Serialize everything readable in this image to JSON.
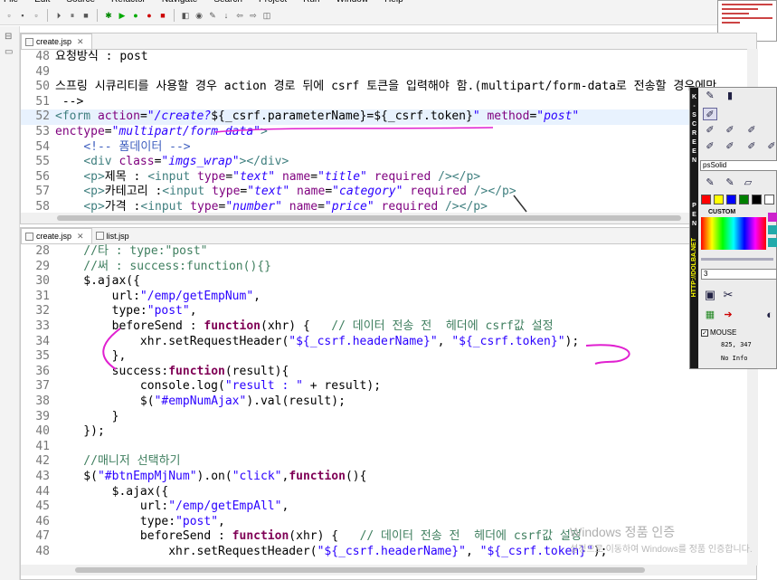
{
  "menu": [
    "File",
    "Edit",
    "Source",
    "Refactor",
    "Navigate",
    "Search",
    "Project",
    "Run",
    "Window",
    "Help"
  ],
  "top_editor": {
    "tab_label": "create.jsp",
    "tab_close": "✕",
    "lines": [
      {
        "n": "48",
        "segs": [
          {
            "c": "tx",
            "t": "요청방식 : post"
          }
        ]
      },
      {
        "n": "49",
        "segs": [
          {
            "c": "tx",
            "t": ""
          }
        ]
      },
      {
        "n": "50",
        "segs": [
          {
            "c": "tx",
            "t": "스프링 시큐리티를 사용할 경우 action 경로 뒤에 csrf 토큰을 입력해야 함.(multipart/form-data로 전송할 경우에만"
          }
        ]
      },
      {
        "n": "51",
        "segs": [
          {
            "c": "tx",
            "t": " -->"
          }
        ]
      },
      {
        "n": "52",
        "segs": [
          {
            "c": "tag",
            "t": "<form "
          },
          {
            "c": "attr",
            "t": "action"
          },
          {
            "c": "tx",
            "t": "="
          },
          {
            "c": "str",
            "t": "\"/create?"
          },
          {
            "c": "tx",
            "t": "${_csrf.parameterName}=${_csrf.token}"
          },
          {
            "c": "str",
            "t": "\""
          },
          {
            "c": "tx",
            "t": " "
          },
          {
            "c": "attr",
            "t": "method"
          },
          {
            "c": "tx",
            "t": "="
          },
          {
            "c": "str",
            "t": "\"post\""
          }
        ]
      },
      {
        "n": "53",
        "segs": [
          {
            "c": "attr",
            "t": "enctype"
          },
          {
            "c": "tx",
            "t": "="
          },
          {
            "c": "str",
            "t": "\"multipart/form-data\""
          },
          {
            "c": "tag",
            "t": ">"
          }
        ]
      },
      {
        "n": "54",
        "segs": [
          {
            "c": "tx",
            "t": "    "
          },
          {
            "c": "cm",
            "t": "<!-- 폼데이터 -->"
          }
        ]
      },
      {
        "n": "55",
        "segs": [
          {
            "c": "tx",
            "t": "    "
          },
          {
            "c": "tag",
            "t": "<div "
          },
          {
            "c": "attr",
            "t": "class"
          },
          {
            "c": "tx",
            "t": "="
          },
          {
            "c": "str",
            "t": "\"imgs_wrap\""
          },
          {
            "c": "tag",
            "t": "></div>"
          }
        ]
      },
      {
        "n": "56",
        "segs": [
          {
            "c": "tx",
            "t": "    "
          },
          {
            "c": "tag",
            "t": "<p>"
          },
          {
            "c": "tx",
            "t": "제목 : "
          },
          {
            "c": "tag",
            "t": "<input "
          },
          {
            "c": "attr",
            "t": "type"
          },
          {
            "c": "tx",
            "t": "="
          },
          {
            "c": "str",
            "t": "\"text\""
          },
          {
            "c": "tx",
            "t": " "
          },
          {
            "c": "attr",
            "t": "name"
          },
          {
            "c": "tx",
            "t": "="
          },
          {
            "c": "str",
            "t": "\"title\""
          },
          {
            "c": "tx",
            "t": " "
          },
          {
            "c": "attr",
            "t": "required"
          },
          {
            "c": "tx",
            "t": " "
          },
          {
            "c": "tag",
            "t": "/></p>"
          }
        ]
      },
      {
        "n": "57",
        "segs": [
          {
            "c": "tx",
            "t": "    "
          },
          {
            "c": "tag",
            "t": "<p>"
          },
          {
            "c": "tx",
            "t": "카테고리 :"
          },
          {
            "c": "tag",
            "t": "<input "
          },
          {
            "c": "attr",
            "t": "type"
          },
          {
            "c": "tx",
            "t": "="
          },
          {
            "c": "str",
            "t": "\"text\""
          },
          {
            "c": "tx",
            "t": " "
          },
          {
            "c": "attr",
            "t": "name"
          },
          {
            "c": "tx",
            "t": "="
          },
          {
            "c": "str",
            "t": "\"category\""
          },
          {
            "c": "tx",
            "t": " "
          },
          {
            "c": "attr",
            "t": "required"
          },
          {
            "c": "tx",
            "t": " "
          },
          {
            "c": "tag",
            "t": "/></p>"
          }
        ]
      },
      {
        "n": "58",
        "segs": [
          {
            "c": "tx",
            "t": "    "
          },
          {
            "c": "tag",
            "t": "<p>"
          },
          {
            "c": "tx",
            "t": "가격 :"
          },
          {
            "c": "tag",
            "t": "<input "
          },
          {
            "c": "attr",
            "t": "type"
          },
          {
            "c": "tx",
            "t": "="
          },
          {
            "c": "str",
            "t": "\"number\""
          },
          {
            "c": "tx",
            "t": " "
          },
          {
            "c": "attr",
            "t": "name"
          },
          {
            "c": "tx",
            "t": "="
          },
          {
            "c": "str",
            "t": "\"price\""
          },
          {
            "c": "tx",
            "t": " "
          },
          {
            "c": "attr",
            "t": "required"
          },
          {
            "c": "tx",
            "t": " "
          },
          {
            "c": "tag",
            "t": "/></p>"
          }
        ]
      }
    ]
  },
  "bottom_editor": {
    "tabs": [
      {
        "label": "create.jsp",
        "close": "✕"
      },
      {
        "label": "list.jsp",
        "close": ""
      }
    ],
    "lines": [
      {
        "n": "28",
        "segs": [
          {
            "c": "jcm",
            "t": "    //타 : type:\"post\""
          }
        ]
      },
      {
        "n": "29",
        "segs": [
          {
            "c": "jcm",
            "t": "    //써 : success:function(){}"
          }
        ]
      },
      {
        "n": "30",
        "segs": [
          {
            "c": "tx",
            "t": "    $.ajax({"
          }
        ]
      },
      {
        "n": "31",
        "segs": [
          {
            "c": "tx",
            "t": "        url:"
          },
          {
            "c": "s",
            "t": "\"/emp/getEmpNum\""
          },
          {
            "c": "tx",
            "t": ","
          }
        ]
      },
      {
        "n": "32",
        "segs": [
          {
            "c": "tx",
            "t": "        type:"
          },
          {
            "c": "s",
            "t": "\"post\""
          },
          {
            "c": "tx",
            "t": ","
          }
        ]
      },
      {
        "n": "33",
        "segs": [
          {
            "c": "tx",
            "t": "        beforeSend : "
          },
          {
            "c": "kw",
            "t": "function"
          },
          {
            "c": "tx",
            "t": "(xhr) {   "
          },
          {
            "c": "jcm",
            "t": "// 데이터 전송 전  헤더에 csrf값 설정"
          }
        ]
      },
      {
        "n": "34",
        "segs": [
          {
            "c": "tx",
            "t": "            xhr.setRequestHeader("
          },
          {
            "c": "s",
            "t": "\"${_csrf.headerName}\""
          },
          {
            "c": "tx",
            "t": ", "
          },
          {
            "c": "s",
            "t": "\"${_csrf.token}\""
          },
          {
            "c": "tx",
            "t": ");"
          }
        ]
      },
      {
        "n": "35",
        "segs": [
          {
            "c": "tx",
            "t": "        },"
          }
        ]
      },
      {
        "n": "36",
        "segs": [
          {
            "c": "tx",
            "t": "        success:"
          },
          {
            "c": "kw",
            "t": "function"
          },
          {
            "c": "tx",
            "t": "(result){"
          }
        ]
      },
      {
        "n": "37",
        "segs": [
          {
            "c": "tx",
            "t": "            console.log("
          },
          {
            "c": "s",
            "t": "\"result : \""
          },
          {
            "c": "tx",
            "t": " + result);"
          }
        ]
      },
      {
        "n": "38",
        "segs": [
          {
            "c": "tx",
            "t": "            $("
          },
          {
            "c": "s",
            "t": "\"#empNumAjax\""
          },
          {
            "c": "tx",
            "t": ").val(result);"
          }
        ]
      },
      {
        "n": "39",
        "segs": [
          {
            "c": "tx",
            "t": "        }"
          }
        ]
      },
      {
        "n": "40",
        "segs": [
          {
            "c": "tx",
            "t": "    });"
          }
        ]
      },
      {
        "n": "41",
        "segs": [
          {
            "c": "tx",
            "t": ""
          }
        ]
      },
      {
        "n": "42",
        "segs": [
          {
            "c": "jcm",
            "t": "    //매니저 선택하기"
          }
        ]
      },
      {
        "n": "43",
        "segs": [
          {
            "c": "tx",
            "t": "    $("
          },
          {
            "c": "s",
            "t": "\"#btnEmpMjNum\""
          },
          {
            "c": "tx",
            "t": ").on("
          },
          {
            "c": "s",
            "t": "\"click\""
          },
          {
            "c": "tx",
            "t": ","
          },
          {
            "c": "kw",
            "t": "function"
          },
          {
            "c": "tx",
            "t": "(){"
          }
        ]
      },
      {
        "n": "44",
        "segs": [
          {
            "c": "tx",
            "t": "        $.ajax({"
          }
        ]
      },
      {
        "n": "45",
        "segs": [
          {
            "c": "tx",
            "t": "            url:"
          },
          {
            "c": "s",
            "t": "\"/emp/getEmpAll\""
          },
          {
            "c": "tx",
            "t": ","
          }
        ]
      },
      {
        "n": "46",
        "segs": [
          {
            "c": "tx",
            "t": "            type:"
          },
          {
            "c": "s",
            "t": "\"post\""
          },
          {
            "c": "tx",
            "t": ","
          }
        ]
      },
      {
        "n": "47",
        "segs": [
          {
            "c": "tx",
            "t": "            beforeSend : "
          },
          {
            "c": "kw",
            "t": "function"
          },
          {
            "c": "tx",
            "t": "(xhr) {   "
          },
          {
            "c": "jcm",
            "t": "// 데이터 전송 전  헤더에 csrf값 설정"
          }
        ]
      },
      {
        "n": "48",
        "segs": [
          {
            "c": "tx",
            "t": "                xhr.setRequestHeader("
          },
          {
            "c": "s",
            "t": "\"${_csrf.headerName}\""
          },
          {
            "c": "tx",
            "t": ", "
          },
          {
            "c": "s",
            "t": "\"${_csrf.token}\""
          },
          {
            "c": "tx",
            "t": ");"
          }
        ]
      }
    ]
  },
  "screen_pen": {
    "strip_letters": [
      "K",
      "-",
      "S",
      "C",
      "R",
      "E",
      "E",
      "N"
    ],
    "strip_letters2": [
      "P",
      "E",
      "N"
    ],
    "link": "HTTP://DOLBA.NET",
    "style_value": "psSolid",
    "custom_label": "CUSTOM",
    "width_value": "3",
    "mouse_label": "MOUSE",
    "coords": "825, 347",
    "info": "No Info",
    "swatches": [
      "#ff0000",
      "#ffff00",
      "#0000ff",
      "#008000",
      "#000000",
      "#ffffff"
    ]
  },
  "watermark": {
    "title": "Windows 정품 인증",
    "text": "설정으로 이동하여 Windows를 정품 인증합니다."
  }
}
